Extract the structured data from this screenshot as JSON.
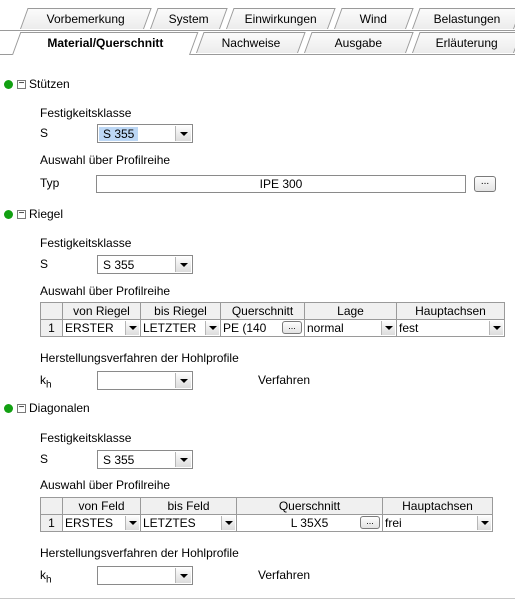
{
  "tabs_row1": [
    "Vorbemerkung",
    "System",
    "Einwirkungen",
    "Wind",
    "Belastungen"
  ],
  "tabs_row2": [
    "Material/Querschnitt",
    "Nachweise",
    "Ausgabe",
    "Erläuterung"
  ],
  "stuetzen": {
    "title": "Stützen",
    "festigkeit_label": "Festigkeitsklasse",
    "s_label": "S",
    "s_value": "S 355",
    "auswahl_label": "Auswahl über Profilreihe",
    "typ_label": "Typ",
    "typ_value": "IPE 300",
    "btn": "..."
  },
  "riegel": {
    "title": "Riegel",
    "festigkeit_label": "Festigkeitsklasse",
    "s_label": "S",
    "s_value": "S 355",
    "auswahl_label": "Auswahl über Profilreihe",
    "headers": [
      "",
      "von Riegel",
      "bis Riegel",
      "Querschnitt",
      "Lage",
      "Hauptachsen"
    ],
    "row": {
      "num": "1",
      "von": "ERSTER",
      "bis": "LETZTER",
      "querschnitt": "PE (140",
      "lage": "normal",
      "haupt": "fest",
      "btn": "..."
    },
    "herstellung_label": "Herstellungsverfahren der Hohlprofile",
    "kh_k": "k",
    "kh_sub": "h",
    "verfahren_label": "Verfahren"
  },
  "diagonalen": {
    "title": "Diagonalen",
    "festigkeit_label": "Festigkeitsklasse",
    "s_label": "S",
    "s_value": "S 355",
    "auswahl_label": "Auswahl über Profilreihe",
    "headers": [
      "",
      "von Feld",
      "bis Feld",
      "Querschnitt",
      "Hauptachsen"
    ],
    "row": {
      "num": "1",
      "von": "ERSTES",
      "bis": "LETZTES",
      "querschnitt": "L 35X5",
      "haupt": "frei",
      "btn": "..."
    },
    "herstellung_label": "Herstellungsverfahren der Hohlprofile",
    "kh_k": "k",
    "kh_sub": "h",
    "verfahren_label": "Verfahren"
  },
  "colors": {
    "status_dot": "#12a012",
    "selection": "#bcd7f5"
  }
}
